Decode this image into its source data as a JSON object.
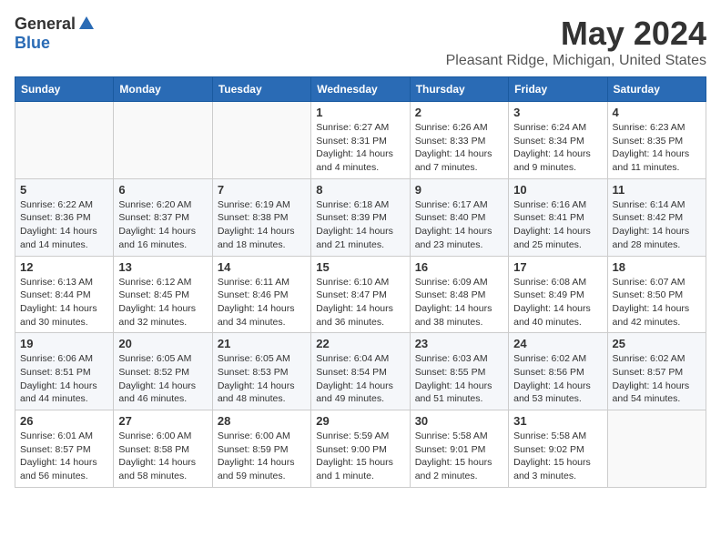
{
  "header": {
    "logo_general": "General",
    "logo_blue": "Blue",
    "month_year": "May 2024",
    "location": "Pleasant Ridge, Michigan, United States"
  },
  "days_of_week": [
    "Sunday",
    "Monday",
    "Tuesday",
    "Wednesday",
    "Thursday",
    "Friday",
    "Saturday"
  ],
  "weeks": [
    [
      {
        "day": "",
        "info": ""
      },
      {
        "day": "",
        "info": ""
      },
      {
        "day": "",
        "info": ""
      },
      {
        "day": "1",
        "info": "Sunrise: 6:27 AM\nSunset: 8:31 PM\nDaylight: 14 hours\nand 4 minutes."
      },
      {
        "day": "2",
        "info": "Sunrise: 6:26 AM\nSunset: 8:33 PM\nDaylight: 14 hours\nand 7 minutes."
      },
      {
        "day": "3",
        "info": "Sunrise: 6:24 AM\nSunset: 8:34 PM\nDaylight: 14 hours\nand 9 minutes."
      },
      {
        "day": "4",
        "info": "Sunrise: 6:23 AM\nSunset: 8:35 PM\nDaylight: 14 hours\nand 11 minutes."
      }
    ],
    [
      {
        "day": "5",
        "info": "Sunrise: 6:22 AM\nSunset: 8:36 PM\nDaylight: 14 hours\nand 14 minutes."
      },
      {
        "day": "6",
        "info": "Sunrise: 6:20 AM\nSunset: 8:37 PM\nDaylight: 14 hours\nand 16 minutes."
      },
      {
        "day": "7",
        "info": "Sunrise: 6:19 AM\nSunset: 8:38 PM\nDaylight: 14 hours\nand 18 minutes."
      },
      {
        "day": "8",
        "info": "Sunrise: 6:18 AM\nSunset: 8:39 PM\nDaylight: 14 hours\nand 21 minutes."
      },
      {
        "day": "9",
        "info": "Sunrise: 6:17 AM\nSunset: 8:40 PM\nDaylight: 14 hours\nand 23 minutes."
      },
      {
        "day": "10",
        "info": "Sunrise: 6:16 AM\nSunset: 8:41 PM\nDaylight: 14 hours\nand 25 minutes."
      },
      {
        "day": "11",
        "info": "Sunrise: 6:14 AM\nSunset: 8:42 PM\nDaylight: 14 hours\nand 28 minutes."
      }
    ],
    [
      {
        "day": "12",
        "info": "Sunrise: 6:13 AM\nSunset: 8:44 PM\nDaylight: 14 hours\nand 30 minutes."
      },
      {
        "day": "13",
        "info": "Sunrise: 6:12 AM\nSunset: 8:45 PM\nDaylight: 14 hours\nand 32 minutes."
      },
      {
        "day": "14",
        "info": "Sunrise: 6:11 AM\nSunset: 8:46 PM\nDaylight: 14 hours\nand 34 minutes."
      },
      {
        "day": "15",
        "info": "Sunrise: 6:10 AM\nSunset: 8:47 PM\nDaylight: 14 hours\nand 36 minutes."
      },
      {
        "day": "16",
        "info": "Sunrise: 6:09 AM\nSunset: 8:48 PM\nDaylight: 14 hours\nand 38 minutes."
      },
      {
        "day": "17",
        "info": "Sunrise: 6:08 AM\nSunset: 8:49 PM\nDaylight: 14 hours\nand 40 minutes."
      },
      {
        "day": "18",
        "info": "Sunrise: 6:07 AM\nSunset: 8:50 PM\nDaylight: 14 hours\nand 42 minutes."
      }
    ],
    [
      {
        "day": "19",
        "info": "Sunrise: 6:06 AM\nSunset: 8:51 PM\nDaylight: 14 hours\nand 44 minutes."
      },
      {
        "day": "20",
        "info": "Sunrise: 6:05 AM\nSunset: 8:52 PM\nDaylight: 14 hours\nand 46 minutes."
      },
      {
        "day": "21",
        "info": "Sunrise: 6:05 AM\nSunset: 8:53 PM\nDaylight: 14 hours\nand 48 minutes."
      },
      {
        "day": "22",
        "info": "Sunrise: 6:04 AM\nSunset: 8:54 PM\nDaylight: 14 hours\nand 49 minutes."
      },
      {
        "day": "23",
        "info": "Sunrise: 6:03 AM\nSunset: 8:55 PM\nDaylight: 14 hours\nand 51 minutes."
      },
      {
        "day": "24",
        "info": "Sunrise: 6:02 AM\nSunset: 8:56 PM\nDaylight: 14 hours\nand 53 minutes."
      },
      {
        "day": "25",
        "info": "Sunrise: 6:02 AM\nSunset: 8:57 PM\nDaylight: 14 hours\nand 54 minutes."
      }
    ],
    [
      {
        "day": "26",
        "info": "Sunrise: 6:01 AM\nSunset: 8:57 PM\nDaylight: 14 hours\nand 56 minutes."
      },
      {
        "day": "27",
        "info": "Sunrise: 6:00 AM\nSunset: 8:58 PM\nDaylight: 14 hours\nand 58 minutes."
      },
      {
        "day": "28",
        "info": "Sunrise: 6:00 AM\nSunset: 8:59 PM\nDaylight: 14 hours\nand 59 minutes."
      },
      {
        "day": "29",
        "info": "Sunrise: 5:59 AM\nSunset: 9:00 PM\nDaylight: 15 hours\nand 1 minute."
      },
      {
        "day": "30",
        "info": "Sunrise: 5:58 AM\nSunset: 9:01 PM\nDaylight: 15 hours\nand 2 minutes."
      },
      {
        "day": "31",
        "info": "Sunrise: 5:58 AM\nSunset: 9:02 PM\nDaylight: 15 hours\nand 3 minutes."
      },
      {
        "day": "",
        "info": ""
      }
    ]
  ]
}
